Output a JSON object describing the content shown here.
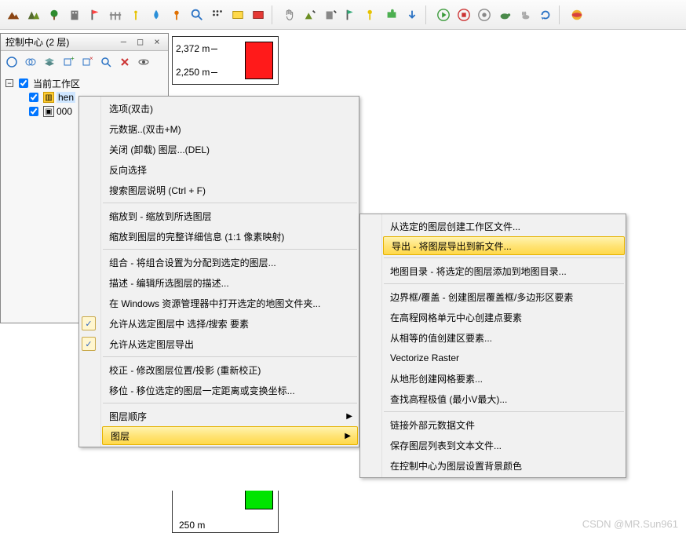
{
  "panel": {
    "title": "控制中心 (2 层)",
    "win_min": "—",
    "win_max": "□",
    "win_close": "×"
  },
  "tree": {
    "root": "当前工作区",
    "layer1": "hen",
    "layer2": "000",
    "collapse": "−"
  },
  "legend": {
    "v1": "2,372 m",
    "v2": "2,250 m",
    "v3": "250 m"
  },
  "menu1": {
    "items": [
      "选项(双击)",
      "元数据..(双击+M)",
      "关闭 (卸载) 图层...(DEL)",
      "反向选择",
      "搜索图层说明 (Ctrl + F)",
      "缩放到 - 缩放到所选图层",
      "缩放到图层的完整详细信息 (1:1 像素映射)",
      "组合 - 将组合设置为分配到选定的图层...",
      "描述 - 编辑所选图层的描述...",
      "在 Windows 资源管理器中打开选定的地图文件夹...",
      "允许从选定图层中 选择/搜索 要素",
      "允许从选定图层导出",
      "校正 - 修改图层位置/投影 (重新校正)",
      "移位 - 移位选定的图层一定距离或变换坐标...",
      "图层顺序",
      "图层"
    ]
  },
  "menu2": {
    "items": [
      "从选定的图层创建工作区文件...",
      "导出 - 将图层导出到新文件...",
      "地图目录 - 将选定的图层添加到地图目录...",
      "边界框/覆盖 - 创建图层覆盖框/多边形区要素",
      "在高程网格单元中心创建点要素",
      "从相等的值创建区要素...",
      "Vectorize Raster",
      "从地形创建网格要素...",
      "查找高程极值 (最小V最大)...",
      "链接外部元数据文件",
      "保存图层列表到文本文件...",
      "在控制中心为图层设置背景颜色"
    ]
  },
  "watermark": "CSDN @MR.Sun961"
}
